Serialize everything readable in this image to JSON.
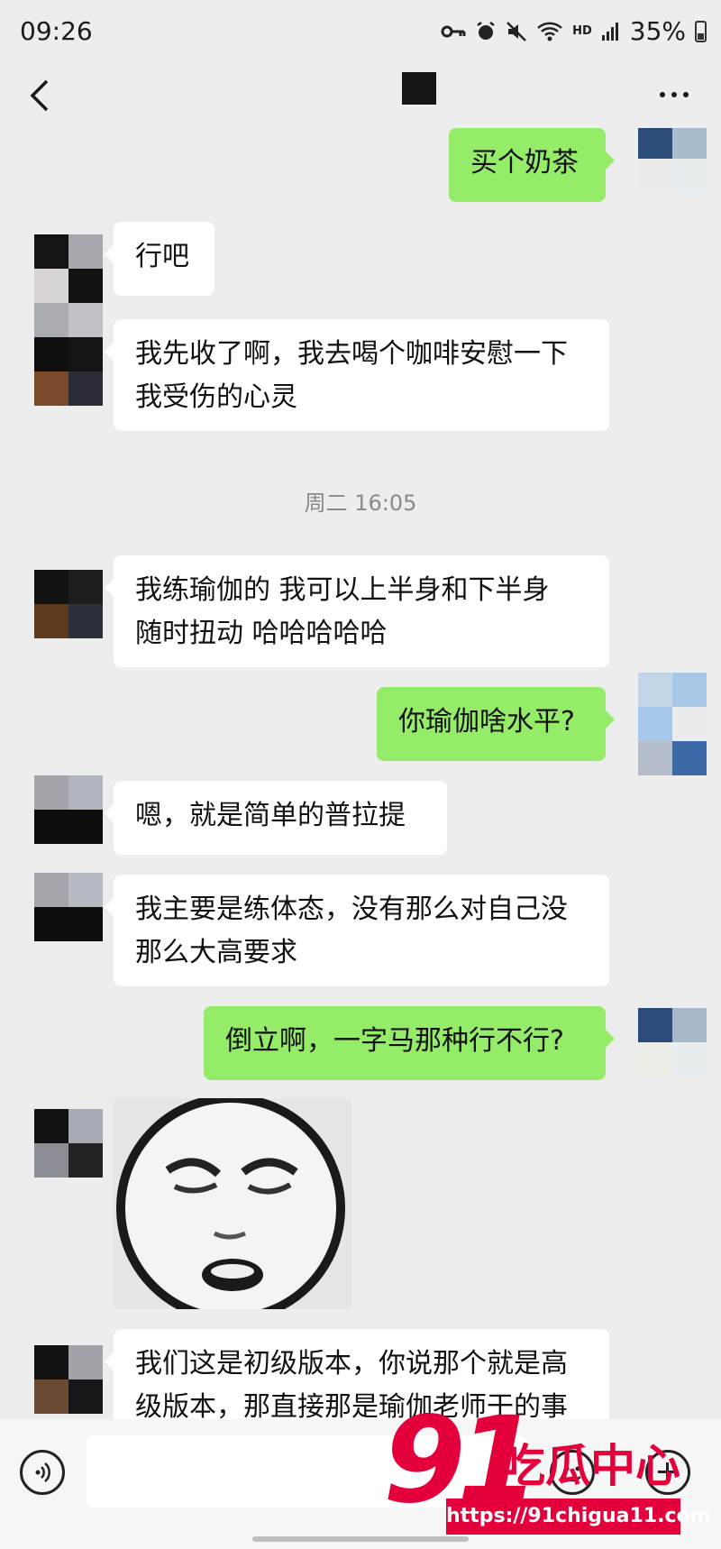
{
  "status_bar": {
    "time": "09:26",
    "icons": [
      "key-icon",
      "alarm-icon",
      "mute-icon",
      "wifi-icon",
      "hd-icon",
      "signal-icon"
    ],
    "hd": "HD",
    "battery": "35%"
  },
  "header": {
    "back_icon": "chevron-left-icon",
    "more_icon": "ellipsis-icon"
  },
  "messages": [
    {
      "side": "out",
      "text": "买个奶茶"
    },
    {
      "side": "in",
      "text": "行吧"
    },
    {
      "side": "in",
      "text": "我先收了啊，我去喝个咖啡安慰一下\n我受伤的心灵"
    },
    {
      "side": "in",
      "text": "我练瑜伽的 我可以上半身和下半身\n随时扭动 哈哈哈哈哈"
    },
    {
      "side": "out",
      "text": "你瑜伽啥水平?"
    },
    {
      "side": "in",
      "text": "嗯，就是简单的普拉提"
    },
    {
      "side": "in",
      "text": "我主要是练体态，没有那么对自己没\n那么大高要求"
    },
    {
      "side": "out",
      "text": "倒立啊，一字马那种行不行?"
    },
    {
      "side": "in",
      "type": "sticker",
      "icon": "face-sticker"
    },
    {
      "side": "in",
      "text": "我们这是初级版本，你说那个就是高\n级版本，那直接那是瑜伽老师干的事"
    }
  ],
  "timestamp": "周二 16:05",
  "input_bar": {
    "voice_icon": "voice-icon",
    "emoji_icon": "emoji-icon",
    "plus_icon": "plus-icon"
  },
  "watermark": {
    "number": "91",
    "name": "吃瓜中心",
    "url": "https://91chigua11.com"
  },
  "colors": {
    "background": "#ededed",
    "incoming": "#ffffff",
    "outgoing": "#95ec69",
    "watermark": "#e3003b"
  }
}
